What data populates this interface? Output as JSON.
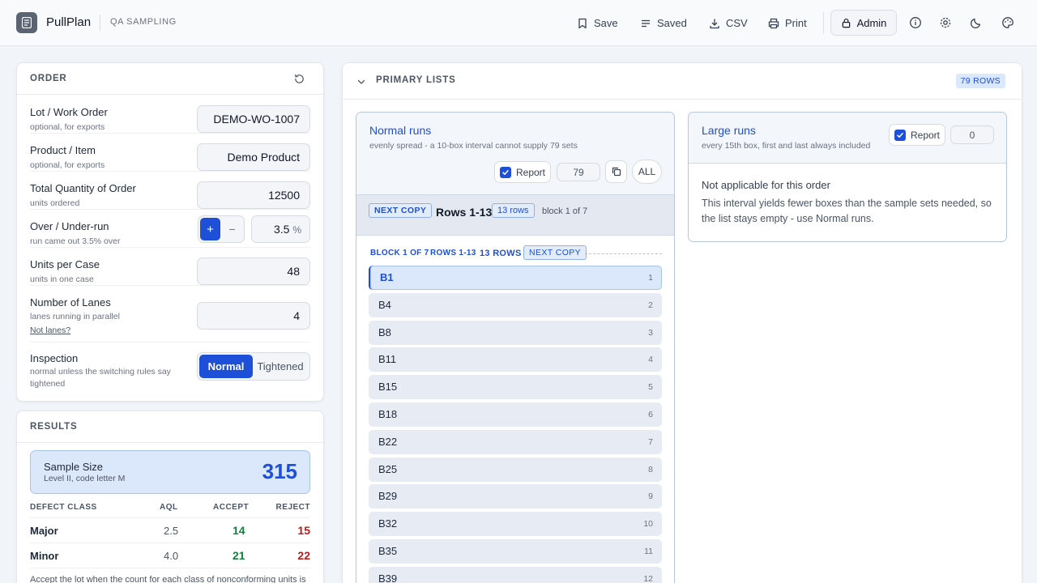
{
  "app": {
    "brand": "PullPlan",
    "subtitle": "QA SAMPLING"
  },
  "toolbar": {
    "save": "Save",
    "saved": "Saved",
    "csv": "CSV",
    "print": "Print",
    "admin": "Admin"
  },
  "order": {
    "title": "ORDER",
    "fields": [
      {
        "label": "Lot / Work Order",
        "hint": "optional, for exports",
        "value": "DEMO-WO-1007"
      },
      {
        "label": "Product / Item",
        "hint": "optional, for exports",
        "value": "Demo Product"
      },
      {
        "label": "Total Quantity of Order",
        "hint": "units ordered",
        "value": "12500"
      },
      {
        "label": "Over / Under-run",
        "hint": "run came out 3.5% over",
        "value": "3.5",
        "unit": "%",
        "plus": "+",
        "minus": "−"
      },
      {
        "label": "Units per Case",
        "hint": "units in one case",
        "value": "48"
      },
      {
        "label": "Number of Lanes",
        "hint": "lanes running in parallel",
        "value": "4",
        "link": "Not lanes?"
      }
    ],
    "inspection": {
      "label": "Inspection",
      "hint": "normal unless the switching rules say tightened",
      "options": [
        "Normal",
        "Tightened"
      ],
      "selected": "Normal"
    }
  },
  "results": {
    "title": "RESULTS",
    "sample": {
      "label": "Sample Size",
      "sub": "Level II, code letter M",
      "value": "315"
    },
    "table": {
      "headers": [
        "DEFECT CLASS",
        "AQL",
        "ACCEPT",
        "REJECT"
      ],
      "rows": [
        {
          "cls": "Major",
          "aql": "2.5",
          "accept": "14",
          "reject": "15"
        },
        {
          "cls": "Minor",
          "aql": "4.0",
          "accept": "21",
          "reject": "22"
        }
      ]
    },
    "note": "Accept the lot when the count for each class of nonconforming units is"
  },
  "primary": {
    "title": "PRIMARY LISTS",
    "badge": "79 ROWS",
    "normal": {
      "title": "Normal runs",
      "sub": "evenly spread - a 10-box interval cannot supply 79 sets",
      "report": "Report",
      "count": "79",
      "all": "ALL",
      "next_copy": "NEXT COPY",
      "rows_label": "Rows 1-13",
      "rows_count": "13 rows",
      "block_label": "block 1 of 7",
      "divider": {
        "block": "BLOCK 1 OF 7",
        "rows": "ROWS 1-13",
        "count": "13 ROWS",
        "next": "NEXT COPY"
      },
      "items": [
        {
          "name": "B1",
          "n": "1"
        },
        {
          "name": "B4",
          "n": "2"
        },
        {
          "name": "B8",
          "n": "3"
        },
        {
          "name": "B11",
          "n": "4"
        },
        {
          "name": "B15",
          "n": "5"
        },
        {
          "name": "B18",
          "n": "6"
        },
        {
          "name": "B22",
          "n": "7"
        },
        {
          "name": "B25",
          "n": "8"
        },
        {
          "name": "B29",
          "n": "9"
        },
        {
          "name": "B32",
          "n": "10"
        },
        {
          "name": "B35",
          "n": "11"
        },
        {
          "name": "B39",
          "n": "12"
        }
      ]
    },
    "large": {
      "title": "Large runs",
      "sub": "every 15th box, first and last always included",
      "report": "Report",
      "count": "0",
      "na_title": "Not applicable for this order",
      "na_text": "This interval yields fewer boxes than the sample sets needed, so the list stays empty - use Normal runs."
    }
  },
  "colors": {
    "accent": "#1d4fd8",
    "accept": "#15803d",
    "reject": "#b91c1c"
  }
}
